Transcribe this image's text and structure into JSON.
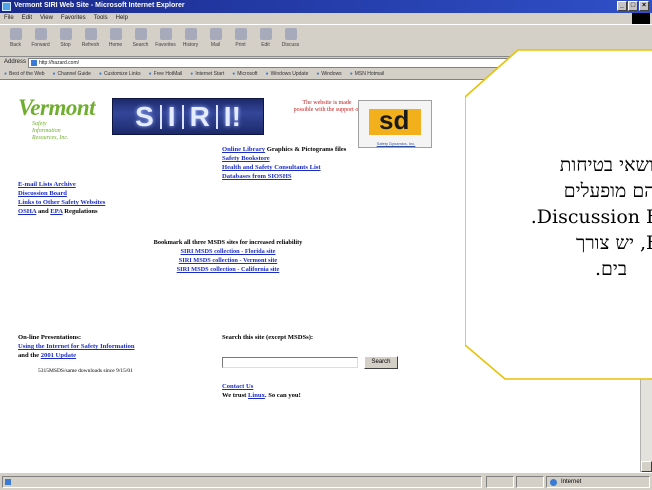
{
  "window": {
    "title": "Vermont SIRI Web Site - Microsoft Internet Explorer",
    "controls": [
      "_",
      "□",
      "×"
    ]
  },
  "menu": [
    "File",
    "Edit",
    "View",
    "Favorites",
    "Tools",
    "Help"
  ],
  "toolbar": [
    "Back",
    "Forward",
    "Stop",
    "Refresh",
    "Home",
    "Search",
    "Favorites",
    "History",
    "Mail",
    "Print",
    "Edit",
    "Discuss"
  ],
  "address": {
    "label": "Address",
    "value": "http://hazard.com/"
  },
  "links": [
    "Best of the Web",
    "Channel Guide",
    "Customize Links",
    "Free HotMail",
    "Internet Start",
    "Microsoft",
    "Windows Update",
    "Windows",
    "MSN Hotmail"
  ],
  "page": {
    "logo": {
      "word": "Vermont",
      "sub": [
        "Safety",
        "Information",
        "Resources, Inc."
      ],
      "siri": [
        "S",
        "I",
        "R",
        "I!"
      ]
    },
    "made_possible": "The website is made possible with the support of",
    "sdi": {
      "letters": "sd",
      "caption": "Safety Dynamics, Inc."
    },
    "library_link": "Online Library",
    "library_rest": " Graphics & Pictograms files",
    "left_links": [
      "E-mail Lists Archive",
      "Discussion Board",
      "Links to Other Safety Websites"
    ],
    "osha_link": "OSHA",
    "and_text": " and ",
    "epa_link": "EPA",
    "regs_text": " Regulations",
    "right_links": [
      "Safety Bookstore",
      "Health and Safety Consultants List",
      "Databases from SIOSHS"
    ],
    "bookmark": {
      "heading": "Bookmark all three MSDS sites for increased reliability",
      "items": [
        "SIRI MSDS collection - Florida site",
        "SIRI MSDS collection - Vermont site",
        "SIRI MSDS collection - California site"
      ]
    },
    "presentations": {
      "heading": "On-line Presentations:",
      "link1": "Using the Internet for Safety Information",
      "and_the": "and the ",
      "link2": "2001 Update"
    },
    "search": {
      "label": "Search this site (except MSDSs):",
      "button": "Search"
    },
    "counter": "5315MSDS/same downloads since 9/15/01",
    "contact_link": "Contact Us",
    "link_to_us_pre": "We trust ",
    "link_to_us_link": "Linux",
    "link_to_us_post": ". So can you!"
  },
  "status": {
    "zone": "Internet"
  },
  "callout": {
    "lines": [
      "נושאי בטיחות",
      "והם מופעלים",
      "Discussion B.",
      "B, יש צורך",
      "בים."
    ]
  },
  "colors": {
    "title_bar": "#1a2a8c",
    "chrome": "#d4d0c8",
    "link": "#1a2cc8",
    "callout_border": "#e8c200",
    "vermont_green": "#6fae2e"
  }
}
